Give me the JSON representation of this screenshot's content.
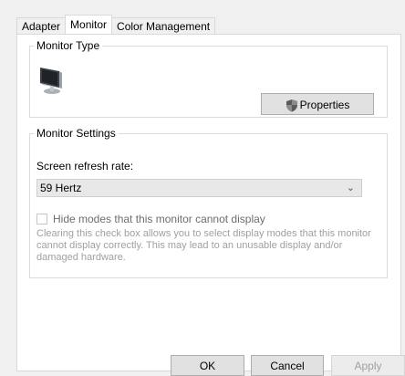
{
  "tabs": [
    {
      "label": "Adapter",
      "active": false
    },
    {
      "label": "Monitor",
      "active": true
    },
    {
      "label": "Color Management",
      "active": false
    }
  ],
  "monitor_type": {
    "title": "Monitor Type",
    "icon": "monitor-icon",
    "properties_label": "Properties",
    "properties_icon": "shield-icon"
  },
  "monitor_settings": {
    "title": "Monitor Settings",
    "refresh_label": "Screen refresh rate:",
    "refresh_value": "59 Hertz",
    "hide_modes_label": "Hide modes that this monitor cannot display",
    "hide_modes_checked": false,
    "hide_modes_enabled": false,
    "description": "Clearing this check box allows you to select display modes that this monitor cannot display correctly. This may lead to an unusable display and/or damaged hardware."
  },
  "buttons": {
    "ok": "OK",
    "cancel": "Cancel",
    "apply": "Apply",
    "apply_enabled": false
  }
}
